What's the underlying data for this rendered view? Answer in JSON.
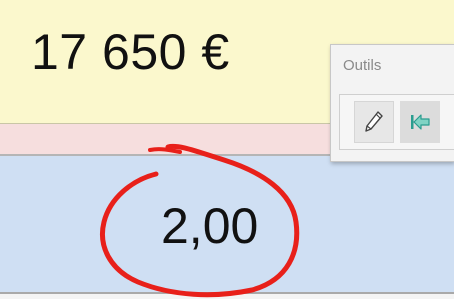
{
  "header": {
    "amount": "17 650 €"
  },
  "cell": {
    "value": "2,00"
  },
  "toolbar": {
    "title": "Outils",
    "buttons": [
      {
        "icon": "pencil-icon"
      },
      {
        "icon": "go-first-arrow-icon",
        "color": "#2a9d8f"
      }
    ]
  },
  "annotation": {
    "color": "#e8201a"
  },
  "colors": {
    "yellow_band": "#fbf8cd",
    "pink_band": "#f6dede",
    "blue_band": "#cfdff3"
  }
}
